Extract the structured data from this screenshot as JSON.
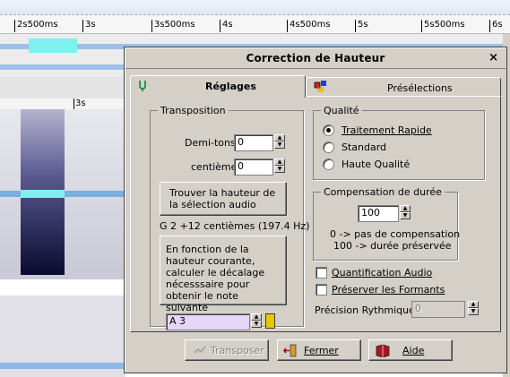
{
  "ruler": {
    "ticks": [
      "2s500ms",
      "3s",
      "3s500ms",
      "4s",
      "4s500ms",
      "5s",
      "5s500ms",
      "6s"
    ]
  },
  "lower_ruler": {
    "tick": "3s"
  },
  "dialog": {
    "title": "Correction de Hauteur",
    "close": "×",
    "tabs": [
      {
        "label": "Réglages",
        "icon": "tuning-fork-icon",
        "active": true
      },
      {
        "label": "Présélections",
        "icon": "presets-icon",
        "active": false
      }
    ],
    "transposition": {
      "legend": "Transposition",
      "semitones_label": "Demi-tons",
      "semitones_value": "0",
      "cents_label": "centièmes",
      "cents_value": "0",
      "find_pitch_button": "Trouver la hauteur de la sélection audio",
      "detected_pitch": "G 2 +12 centièmes (197.4 Hz)",
      "calc_button": "En fonction de la hauteur courante, calculer le décalage nécesssaire pour obtenir le note suivante",
      "target_note": "A 3"
    },
    "quality": {
      "legend": "Qualité",
      "options": [
        "Traitement Rapide",
        "Standard",
        "Haute Qualité"
      ],
      "selected": "Traitement Rapide"
    },
    "duration": {
      "legend": "Compensation de durée",
      "value": "100",
      "hint1": "0 -> pas de compensation",
      "hint2": "100 -> durée préservée"
    },
    "options": {
      "audio_quantize": "Quantification Audio",
      "preserve_formants": "Préserver les Formants",
      "rhythmic_precision_label": "Précision Rythmique",
      "rhythmic_precision_value": "0"
    },
    "footer": {
      "transpose": "Transposer",
      "close": "Fermer",
      "help": "Aide"
    }
  },
  "colors": {
    "dialog_bg": "#d4d0c8",
    "selection": "#7ff0f0",
    "waveform": "#8fb8e8",
    "target_note_bg": "#e6d6f8"
  }
}
